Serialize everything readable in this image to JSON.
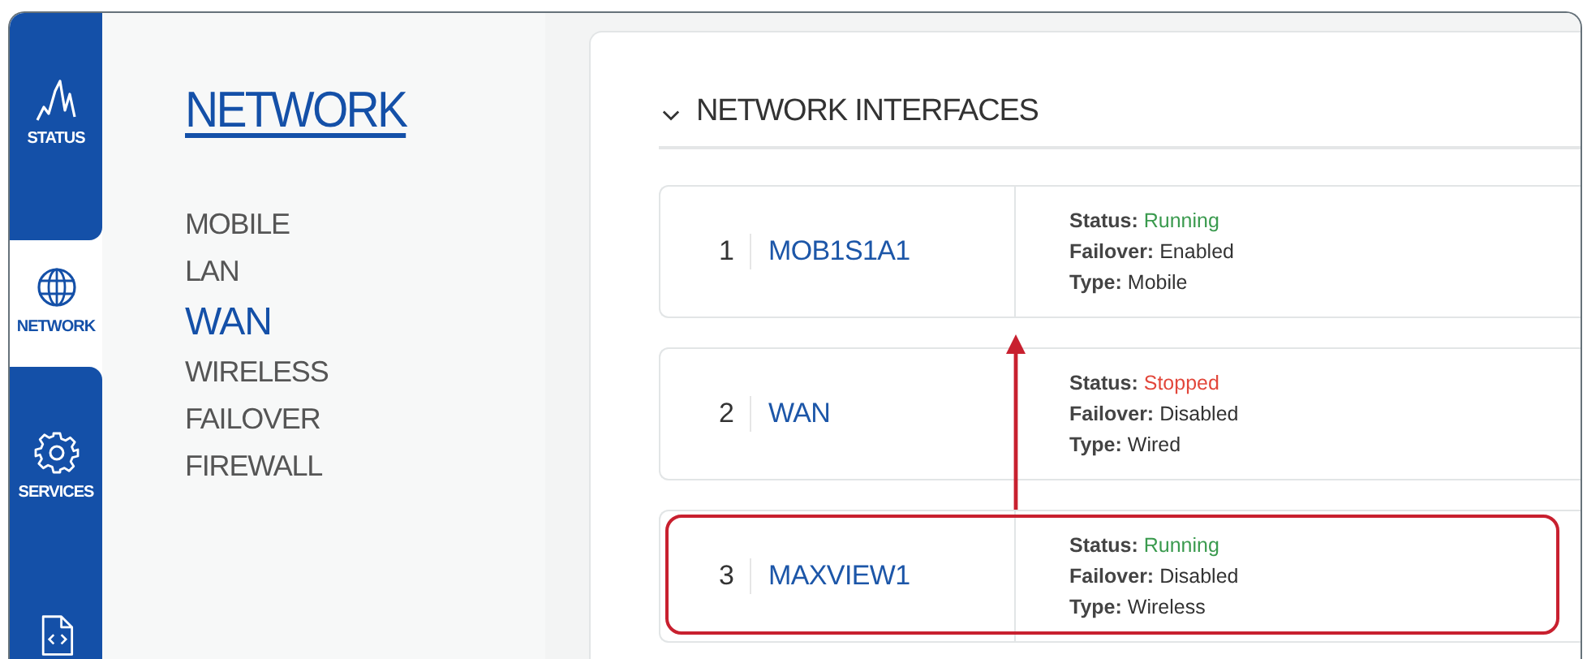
{
  "nav": [
    {
      "label": "STATUS",
      "kind": "status",
      "selected": false
    },
    {
      "label": "NETWORK",
      "kind": "network",
      "selected": true
    },
    {
      "label": "SERVICES",
      "kind": "services",
      "selected": false
    },
    {
      "kind": "system",
      "selected": false
    }
  ],
  "submenu": {
    "title": "NETWORK",
    "items": [
      {
        "label": "MOBILE",
        "selected": false
      },
      {
        "label": "LAN",
        "selected": false
      },
      {
        "label": "WAN",
        "selected": true
      },
      {
        "label": "WIRELESS",
        "selected": false
      },
      {
        "label": "FAILOVER",
        "selected": false
      },
      {
        "label": "FIREWALL",
        "selected": false
      }
    ]
  },
  "section": {
    "title": "NETWORK INTERFACES",
    "expanded": true,
    "interfaces": [
      {
        "number": "1",
        "name": "MOB1S1A1",
        "highlighted": false,
        "details": [
          {
            "label": "Status:",
            "value": "Running",
            "color": "#3a9a4e"
          },
          {
            "label": "Failover:",
            "value": "Enabled"
          },
          {
            "label": "Type:",
            "value": "Mobile"
          }
        ]
      },
      {
        "number": "2",
        "name": "WAN",
        "highlighted": false,
        "details": [
          {
            "label": "Status:",
            "value": "Stopped",
            "color": "#e2463a"
          },
          {
            "label": "Failover:",
            "value": "Disabled"
          },
          {
            "label": "Type:",
            "value": "Wired"
          }
        ]
      },
      {
        "number": "3",
        "name": "MAXVIEW1",
        "highlighted": true,
        "details": [
          {
            "label": "Status:",
            "value": "Running",
            "color": "#3a9a4e"
          },
          {
            "label": "Failover:",
            "value": "Disabled"
          },
          {
            "label": "Type:",
            "value": "Wireless"
          }
        ]
      }
    ]
  }
}
